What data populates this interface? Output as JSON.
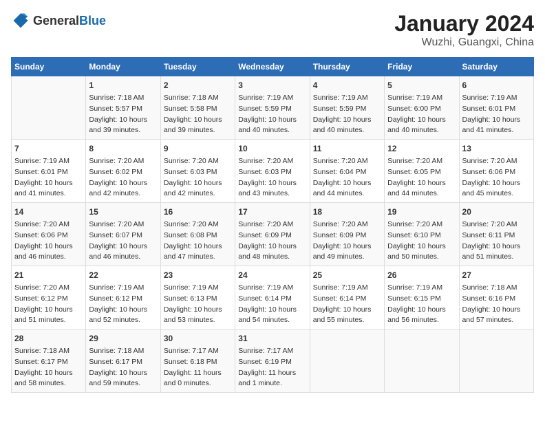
{
  "header": {
    "logo": {
      "general": "General",
      "blue": "Blue"
    },
    "title": "January 2024",
    "subtitle": "Wuzhi, Guangxi, China"
  },
  "calendar": {
    "days_of_week": [
      "Sunday",
      "Monday",
      "Tuesday",
      "Wednesday",
      "Thursday",
      "Friday",
      "Saturday"
    ],
    "weeks": [
      [
        {
          "day": "",
          "content": ""
        },
        {
          "day": "1",
          "content": "Sunrise: 7:18 AM\nSunset: 5:57 PM\nDaylight: 10 hours\nand 39 minutes."
        },
        {
          "day": "2",
          "content": "Sunrise: 7:18 AM\nSunset: 5:58 PM\nDaylight: 10 hours\nand 39 minutes."
        },
        {
          "day": "3",
          "content": "Sunrise: 7:19 AM\nSunset: 5:59 PM\nDaylight: 10 hours\nand 40 minutes."
        },
        {
          "day": "4",
          "content": "Sunrise: 7:19 AM\nSunset: 5:59 PM\nDaylight: 10 hours\nand 40 minutes."
        },
        {
          "day": "5",
          "content": "Sunrise: 7:19 AM\nSunset: 6:00 PM\nDaylight: 10 hours\nand 40 minutes."
        },
        {
          "day": "6",
          "content": "Sunrise: 7:19 AM\nSunset: 6:01 PM\nDaylight: 10 hours\nand 41 minutes."
        }
      ],
      [
        {
          "day": "7",
          "content": "Sunrise: 7:19 AM\nSunset: 6:01 PM\nDaylight: 10 hours\nand 41 minutes."
        },
        {
          "day": "8",
          "content": "Sunrise: 7:20 AM\nSunset: 6:02 PM\nDaylight: 10 hours\nand 42 minutes."
        },
        {
          "day": "9",
          "content": "Sunrise: 7:20 AM\nSunset: 6:03 PM\nDaylight: 10 hours\nand 42 minutes."
        },
        {
          "day": "10",
          "content": "Sunrise: 7:20 AM\nSunset: 6:03 PM\nDaylight: 10 hours\nand 43 minutes."
        },
        {
          "day": "11",
          "content": "Sunrise: 7:20 AM\nSunset: 6:04 PM\nDaylight: 10 hours\nand 44 minutes."
        },
        {
          "day": "12",
          "content": "Sunrise: 7:20 AM\nSunset: 6:05 PM\nDaylight: 10 hours\nand 44 minutes."
        },
        {
          "day": "13",
          "content": "Sunrise: 7:20 AM\nSunset: 6:06 PM\nDaylight: 10 hours\nand 45 minutes."
        }
      ],
      [
        {
          "day": "14",
          "content": "Sunrise: 7:20 AM\nSunset: 6:06 PM\nDaylight: 10 hours\nand 46 minutes."
        },
        {
          "day": "15",
          "content": "Sunrise: 7:20 AM\nSunset: 6:07 PM\nDaylight: 10 hours\nand 46 minutes."
        },
        {
          "day": "16",
          "content": "Sunrise: 7:20 AM\nSunset: 6:08 PM\nDaylight: 10 hours\nand 47 minutes."
        },
        {
          "day": "17",
          "content": "Sunrise: 7:20 AM\nSunset: 6:09 PM\nDaylight: 10 hours\nand 48 minutes."
        },
        {
          "day": "18",
          "content": "Sunrise: 7:20 AM\nSunset: 6:09 PM\nDaylight: 10 hours\nand 49 minutes."
        },
        {
          "day": "19",
          "content": "Sunrise: 7:20 AM\nSunset: 6:10 PM\nDaylight: 10 hours\nand 50 minutes."
        },
        {
          "day": "20",
          "content": "Sunrise: 7:20 AM\nSunset: 6:11 PM\nDaylight: 10 hours\nand 51 minutes."
        }
      ],
      [
        {
          "day": "21",
          "content": "Sunrise: 7:20 AM\nSunset: 6:12 PM\nDaylight: 10 hours\nand 51 minutes."
        },
        {
          "day": "22",
          "content": "Sunrise: 7:19 AM\nSunset: 6:12 PM\nDaylight: 10 hours\nand 52 minutes."
        },
        {
          "day": "23",
          "content": "Sunrise: 7:19 AM\nSunset: 6:13 PM\nDaylight: 10 hours\nand 53 minutes."
        },
        {
          "day": "24",
          "content": "Sunrise: 7:19 AM\nSunset: 6:14 PM\nDaylight: 10 hours\nand 54 minutes."
        },
        {
          "day": "25",
          "content": "Sunrise: 7:19 AM\nSunset: 6:14 PM\nDaylight: 10 hours\nand 55 minutes."
        },
        {
          "day": "26",
          "content": "Sunrise: 7:19 AM\nSunset: 6:15 PM\nDaylight: 10 hours\nand 56 minutes."
        },
        {
          "day": "27",
          "content": "Sunrise: 7:18 AM\nSunset: 6:16 PM\nDaylight: 10 hours\nand 57 minutes."
        }
      ],
      [
        {
          "day": "28",
          "content": "Sunrise: 7:18 AM\nSunset: 6:17 PM\nDaylight: 10 hours\nand 58 minutes."
        },
        {
          "day": "29",
          "content": "Sunrise: 7:18 AM\nSunset: 6:17 PM\nDaylight: 10 hours\nand 59 minutes."
        },
        {
          "day": "30",
          "content": "Sunrise: 7:17 AM\nSunset: 6:18 PM\nDaylight: 11 hours\nand 0 minutes."
        },
        {
          "day": "31",
          "content": "Sunrise: 7:17 AM\nSunset: 6:19 PM\nDaylight: 11 hours\nand 1 minute."
        },
        {
          "day": "",
          "content": ""
        },
        {
          "day": "",
          "content": ""
        },
        {
          "day": "",
          "content": ""
        }
      ]
    ]
  }
}
